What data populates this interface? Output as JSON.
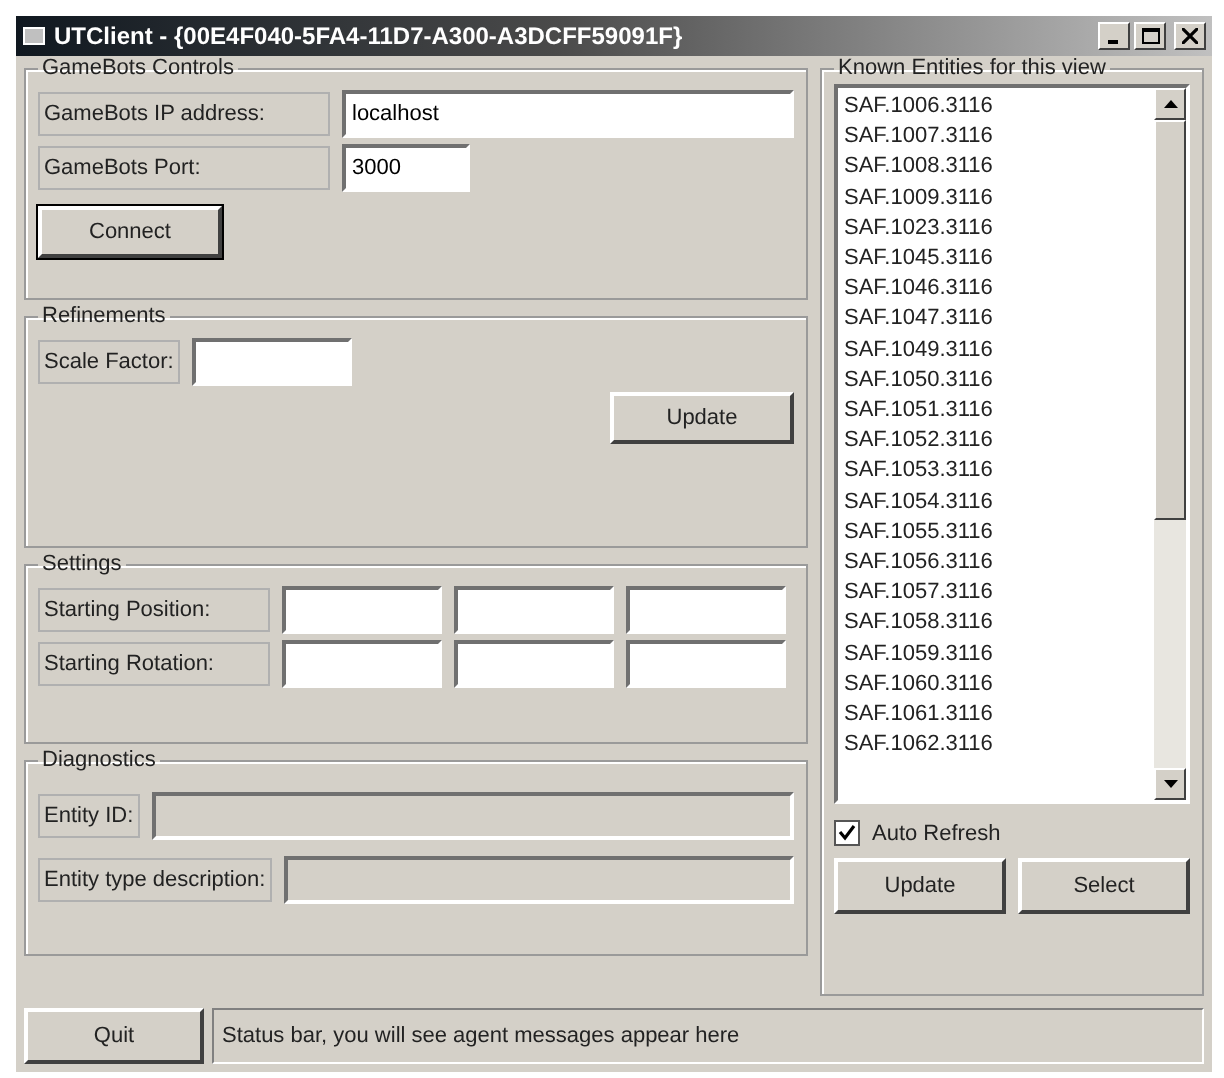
{
  "window": {
    "title": "UTClient - {00E4F040-5FA4-11D7-A300-A3DCFF59091F}"
  },
  "gamebots": {
    "title": "GameBots Controls",
    "ip_label": "GameBots IP address:",
    "ip_value": "localhost",
    "port_label": "GameBots Port:",
    "port_value": "3000",
    "connect": "Connect"
  },
  "refinements": {
    "title": "Refinements",
    "scale_label": "Scale Factor:",
    "update": "Update"
  },
  "settings": {
    "title": "Settings",
    "rows": [
      {
        "label": "Starting Position:"
      },
      {
        "label": "Starting Rotation:"
      }
    ]
  },
  "diagnostics": {
    "title": "Diagnostics",
    "rows": [
      {
        "label": "Entity ID:"
      },
      {
        "label": "Entity type description:"
      }
    ]
  },
  "entities": {
    "title": "Known Entities for this view",
    "items": [
      "SAF.1006.3116",
      "SAF.1007.3116",
      "SAF.1008.3116",
      "SAF.1009.3116",
      "SAF.1023.3116",
      "SAF.1045.3116",
      "SAF.1046.3116",
      "SAF.1047.3116",
      "SAF.1049.3116",
      "SAF.1050.3116",
      "SAF.1051.3116",
      "SAF.1052.3116",
      "SAF.1053.3116",
      "SAF.1054.3116",
      "SAF.1055.3116",
      "SAF.1056.3116",
      "SAF.1057.3116",
      "SAF.1058.3116",
      "SAF.1059.3116",
      "SAF.1060.3116",
      "SAF.1061.3116",
      "SAF.1062.3116"
    ],
    "auto_refresh": {
      "label": "Auto Refresh",
      "checked": true
    },
    "buttons": [
      "Update",
      "Select"
    ]
  },
  "quit": "Quit",
  "status_bar": "Status bar, you will see agent messages appear here"
}
